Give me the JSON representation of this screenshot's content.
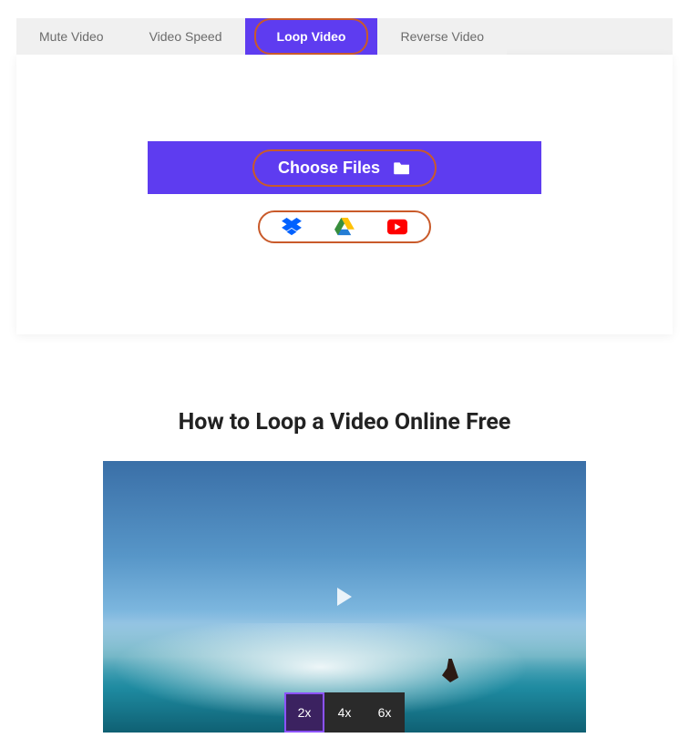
{
  "tabs": [
    {
      "label": "Mute Video",
      "active": false
    },
    {
      "label": "Video Speed",
      "active": false
    },
    {
      "label": "Loop Video",
      "active": true
    },
    {
      "label": "Reverse Video",
      "active": false
    }
  ],
  "upload": {
    "choose_label": "Choose Files",
    "cloud_sources": [
      "dropbox",
      "google-drive",
      "youtube"
    ]
  },
  "heading": "How to Loop a Video Online Free",
  "loop_options": [
    {
      "label": "2x",
      "active": true
    },
    {
      "label": "4x",
      "active": false
    },
    {
      "label": "6x",
      "active": false
    }
  ]
}
